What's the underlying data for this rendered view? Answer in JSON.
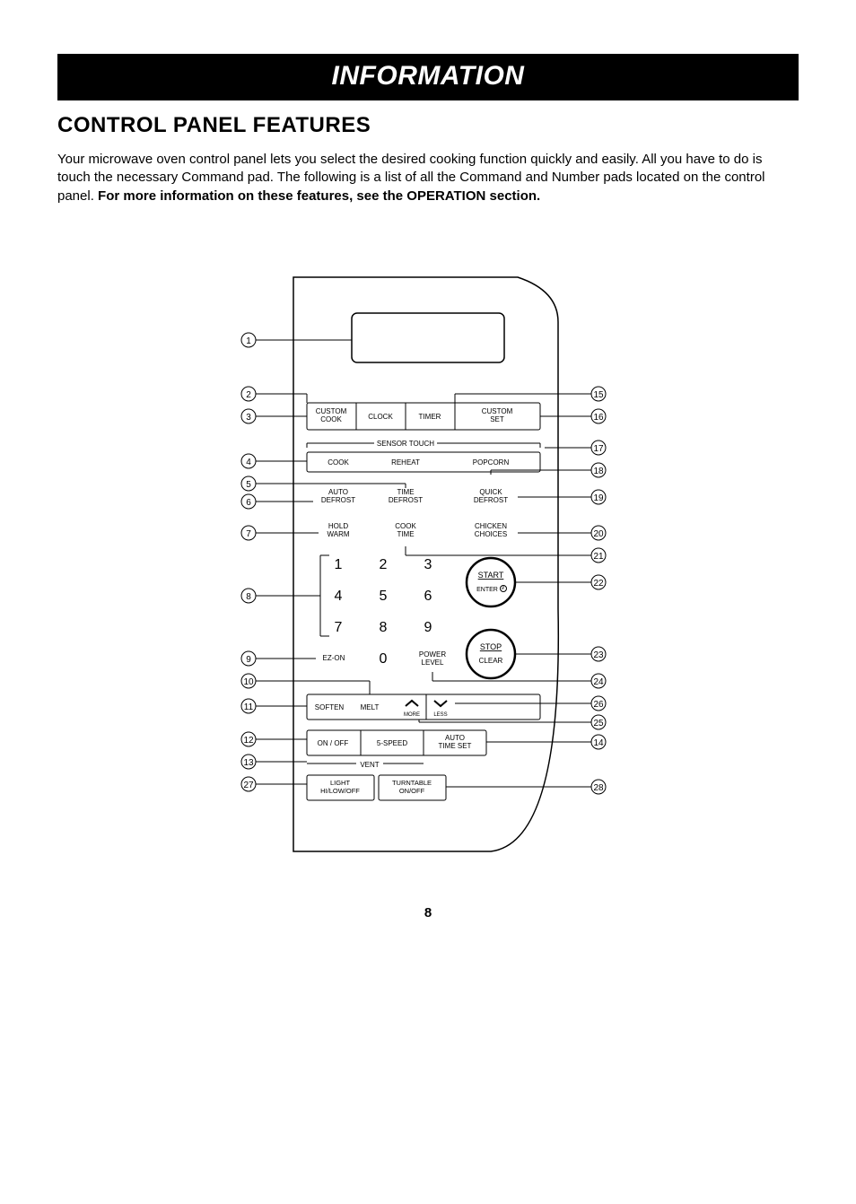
{
  "banner": {
    "title": "INFORMATION"
  },
  "section": {
    "title": "CONTROL PANEL FEATURES"
  },
  "intro": {
    "p1_a": "Your microwave oven control panel lets you select the desired cooking function quickly and easily. All you have to do is touch the necessary Command pad. The following is a list of all the Command and Number pads located on the control panel. ",
    "p1_bold": "For more information on these features, see the OPERATION section."
  },
  "page_number": "8",
  "panel": {
    "row1": {
      "custom_cook": "CUSTOM\nCOOK",
      "clock": "CLOCK",
      "timer": "TIMER",
      "custom_set": "CUSTOM\nSET"
    },
    "sensor_label": "SENSOR TOUCH",
    "sensor": {
      "cook": "COOK",
      "reheat": "REHEAT",
      "popcorn": "POPCORN"
    },
    "row3": {
      "auto_defrost": "AUTO\nDEFROST",
      "time_defrost": "TIME\nDEFROST",
      "quick_defrost": "QUICK\nDEFROST"
    },
    "row4": {
      "hold_warm": "HOLD\nWARM",
      "cook_time": "COOK\nTIME",
      "chicken_choices": "CHICKEN\nCHOICES"
    },
    "keypad": {
      "k1": "1",
      "k2": "2",
      "k3": "3",
      "k4": "4",
      "k5": "5",
      "k6": "6",
      "k7": "7",
      "k8": "8",
      "k9": "9",
      "k0": "0"
    },
    "start": {
      "top": "START",
      "bottom": "ENTER"
    },
    "stop": {
      "top": "STOP",
      "bottom": "CLEAR"
    },
    "ezon": "EZ-ON",
    "power_level": "POWER\nLEVEL",
    "row_soft": {
      "soften": "SOFTEN",
      "melt": "MELT",
      "more": "MORE",
      "less": "LESS"
    },
    "vent_label": "VENT",
    "vent": {
      "onoff": "ON / OFF",
      "speed": "5-SPEED",
      "auto_time": "AUTO\nTIME SET"
    },
    "bottom": {
      "light": "LIGHT\nHI/LOW/OFF",
      "turntable": "TURNTABLE\nON/OFF"
    }
  },
  "callouts_left": {
    "c1": "1",
    "c2": "2",
    "c3": "3",
    "c4": "4",
    "c5": "5",
    "c6": "6",
    "c7": "7",
    "c8": "8",
    "c9": "9",
    "c10": "10",
    "c11": "11",
    "c12": "12",
    "c13": "13",
    "c27": "27"
  },
  "callouts_right": {
    "c15": "15",
    "c16": "16",
    "c17": "17",
    "c18": "18",
    "c19": "19",
    "c20": "20",
    "c21": "21",
    "c22": "22",
    "c23": "23",
    "c24": "24",
    "c26": "26",
    "c25": "25",
    "c14": "14",
    "c28": "28"
  }
}
